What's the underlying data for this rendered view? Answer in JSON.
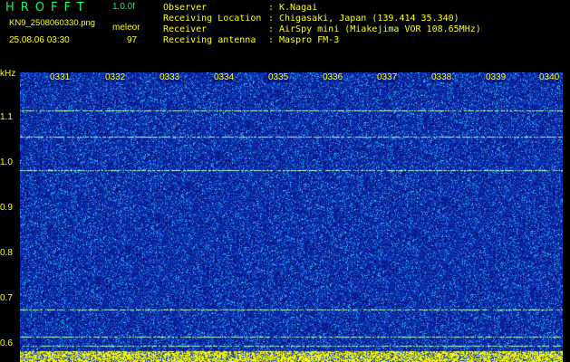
{
  "app": {
    "title": "HROFFT",
    "version": "1.0.0f",
    "filename": "KN9_2508060330.png",
    "mode": "meleor",
    "datetime": "25.08.06 03:30",
    "count": "97"
  },
  "info": [
    {
      "label": "Observer",
      "value": "K.Nagai"
    },
    {
      "label": "Receiving Location",
      "value": "Chigasaki, Japan (139.414 35.340)"
    },
    {
      "label": "Receiver",
      "value": "AirSpy mini (Miakejima VOR 108.65MHz)"
    },
    {
      "label": "Receiving antenna",
      "value": "Maspro FM-3"
    }
  ],
  "axis": {
    "y_unit": "kHz",
    "y_ticks": [
      "1.1",
      "1.0",
      "0.9",
      "0.8",
      "0.7",
      "0.6"
    ],
    "x_ticks": [
      "0331",
      "0332",
      "0333",
      "0334",
      "0335",
      "0336",
      "0337",
      "0338",
      "0339",
      "0340"
    ]
  },
  "colors": {
    "background": "#000000",
    "label": "#ffff00",
    "title": "#00ff66",
    "spectrogram_base": "#1a3ab8"
  }
}
